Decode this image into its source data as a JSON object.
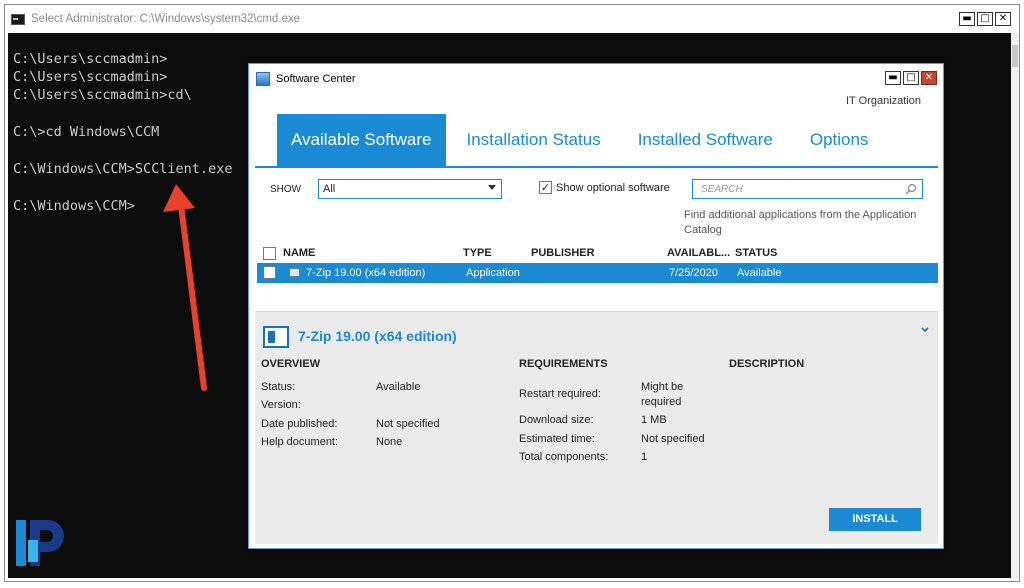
{
  "cmd": {
    "title": "Select Administrator: C:\\Windows\\system32\\cmd.exe",
    "lines": [
      "C:\\Users\\sccmadmin>",
      "C:\\Users\\sccmadmin>",
      "C:\\Users\\sccmadmin>cd\\",
      "C:\\>cd Windows\\CCM",
      "C:\\Windows\\CCM>SCClient.exe",
      "C:\\Windows\\CCM>"
    ],
    "buttons": {
      "minimize": "▬",
      "maximize": "□",
      "close": "✕"
    }
  },
  "software_center": {
    "title": "Software Center",
    "organization": "IT Organization",
    "tabs": [
      "Available Software",
      "Installation Status",
      "Installed Software",
      "Options"
    ],
    "active_tab": "Available Software",
    "show_label": "SHOW",
    "show_value": "All",
    "optional_label": "Show optional software",
    "optional_checked_mark": "✓",
    "search_placeholder": "SEARCH",
    "find_link": "Find additional applications from the Application Catalog",
    "columns": {
      "name": "NAME",
      "type": "TYPE",
      "publisher": "PUBLISHER",
      "available": "AVAILABL...",
      "status": "STATUS"
    },
    "rows": [
      {
        "name": "7-Zip 19.00 (x64 edition)",
        "type": "Application",
        "publisher": "",
        "available": "7/25/2020",
        "status": "Available"
      }
    ],
    "details": {
      "title": "7-Zip 19.00 (x64 edition)",
      "overview_heading": "OVERVIEW",
      "requirements_heading": "REQUIREMENTS",
      "description_heading": "DESCRIPTION",
      "overview": {
        "status_label": "Status:",
        "status_value": "Available",
        "version_label": "Version:",
        "version_value": "",
        "date_label": "Date published:",
        "date_value": "Not specified",
        "help_label": "Help document:",
        "help_value": "None"
      },
      "requirements": {
        "restart_label": "Restart required:",
        "restart_value_1": "Might be",
        "restart_value_2": "required",
        "download_label": "Download size:",
        "download_value": "1 MB",
        "time_label": "Estimated time:",
        "time_value": "Not specified",
        "components_label": "Total components:",
        "components_value": "1"
      },
      "install_label": "INSTALL"
    },
    "buttons": {
      "minimize": "▬",
      "maximize": "□",
      "close": "✕"
    }
  },
  "colors": {
    "accent": "#1a8ad4",
    "console_bg": "#0c0c0c",
    "arrow": "#e8412c"
  }
}
